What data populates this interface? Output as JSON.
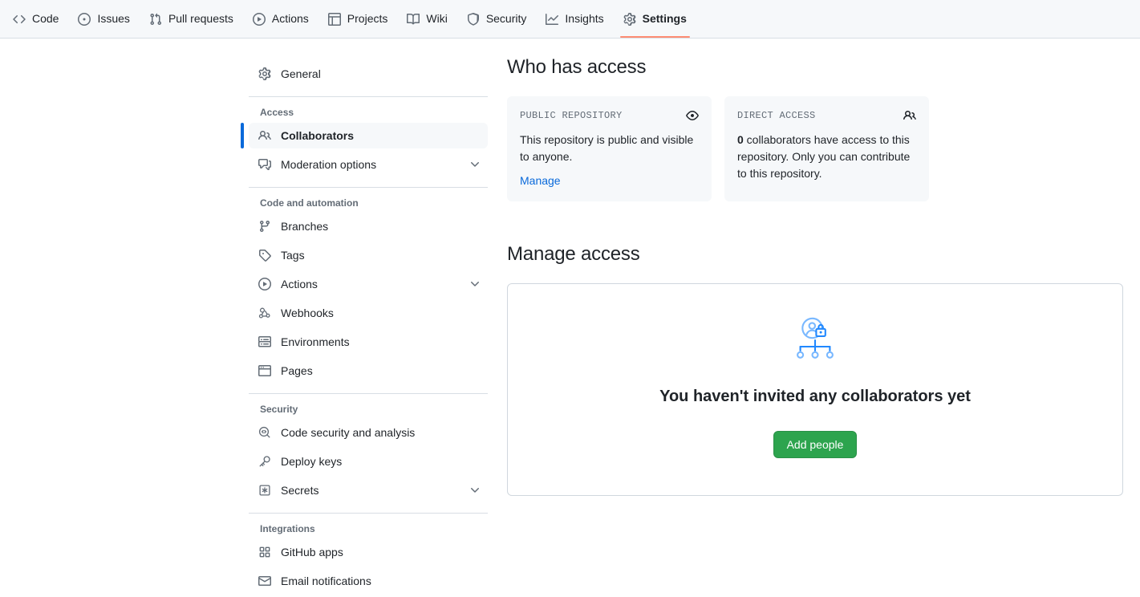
{
  "repo_nav": {
    "items": [
      {
        "label": "Code",
        "icon": "code-icon",
        "active": false
      },
      {
        "label": "Issues",
        "icon": "issue-opened-icon",
        "active": false
      },
      {
        "label": "Pull requests",
        "icon": "git-pull-request-icon",
        "active": false
      },
      {
        "label": "Actions",
        "icon": "play-icon",
        "active": false
      },
      {
        "label": "Projects",
        "icon": "table-icon",
        "active": false
      },
      {
        "label": "Wiki",
        "icon": "book-icon",
        "active": false
      },
      {
        "label": "Security",
        "icon": "shield-icon",
        "active": false
      },
      {
        "label": "Insights",
        "icon": "graph-icon",
        "active": false
      },
      {
        "label": "Settings",
        "icon": "gear-icon",
        "active": true
      }
    ]
  },
  "sidebar": {
    "groups": [
      {
        "heading": null,
        "items": [
          {
            "label": "General",
            "icon": "gear-icon",
            "selected": false,
            "chevron": false
          }
        ]
      },
      {
        "heading": "Access",
        "items": [
          {
            "label": "Collaborators",
            "icon": "people-icon",
            "selected": true,
            "chevron": false
          },
          {
            "label": "Moderation options",
            "icon": "comment-discussion-icon",
            "selected": false,
            "chevron": true
          }
        ]
      },
      {
        "heading": "Code and automation",
        "items": [
          {
            "label": "Branches",
            "icon": "git-branch-icon",
            "selected": false,
            "chevron": false
          },
          {
            "label": "Tags",
            "icon": "tag-icon",
            "selected": false,
            "chevron": false
          },
          {
            "label": "Actions",
            "icon": "play-icon",
            "selected": false,
            "chevron": true
          },
          {
            "label": "Webhooks",
            "icon": "webhook-icon",
            "selected": false,
            "chevron": false
          },
          {
            "label": "Environments",
            "icon": "server-icon",
            "selected": false,
            "chevron": false
          },
          {
            "label": "Pages",
            "icon": "browser-icon",
            "selected": false,
            "chevron": false
          }
        ]
      },
      {
        "heading": "Security",
        "items": [
          {
            "label": "Code security and analysis",
            "icon": "codescan-icon",
            "selected": false,
            "chevron": false
          },
          {
            "label": "Deploy keys",
            "icon": "key-icon",
            "selected": false,
            "chevron": false
          },
          {
            "label": "Secrets",
            "icon": "asterisk-box-icon",
            "selected": false,
            "chevron": true
          }
        ]
      },
      {
        "heading": "Integrations",
        "items": [
          {
            "label": "GitHub apps",
            "icon": "apps-icon",
            "selected": false,
            "chevron": false
          },
          {
            "label": "Email notifications",
            "icon": "mail-icon",
            "selected": false,
            "chevron": false
          }
        ]
      }
    ]
  },
  "main": {
    "access_title": "Who has access",
    "cards": [
      {
        "label": "PUBLIC REPOSITORY",
        "icon": "eye-icon",
        "body": "This repository is public and visible to anyone.",
        "link": "Manage"
      },
      {
        "label": "DIRECT ACCESS",
        "icon": "people-icon",
        "count": "0",
        "body_rest": " collaborators have access to this repository. Only you can contribute to this repository."
      }
    ],
    "manage_title": "Manage access",
    "empty_state": {
      "illustration": "collaborators-lock-illustration",
      "heading": "You haven't invited any collaborators yet",
      "button": "Add people"
    }
  },
  "colors": {
    "accent_blue": "#0969da",
    "active_tab_underline": "#fd8c73",
    "button_green": "#2da44e",
    "card_bg": "#f6f8fa",
    "border": "#d0d7de",
    "muted_text": "#636c76"
  }
}
